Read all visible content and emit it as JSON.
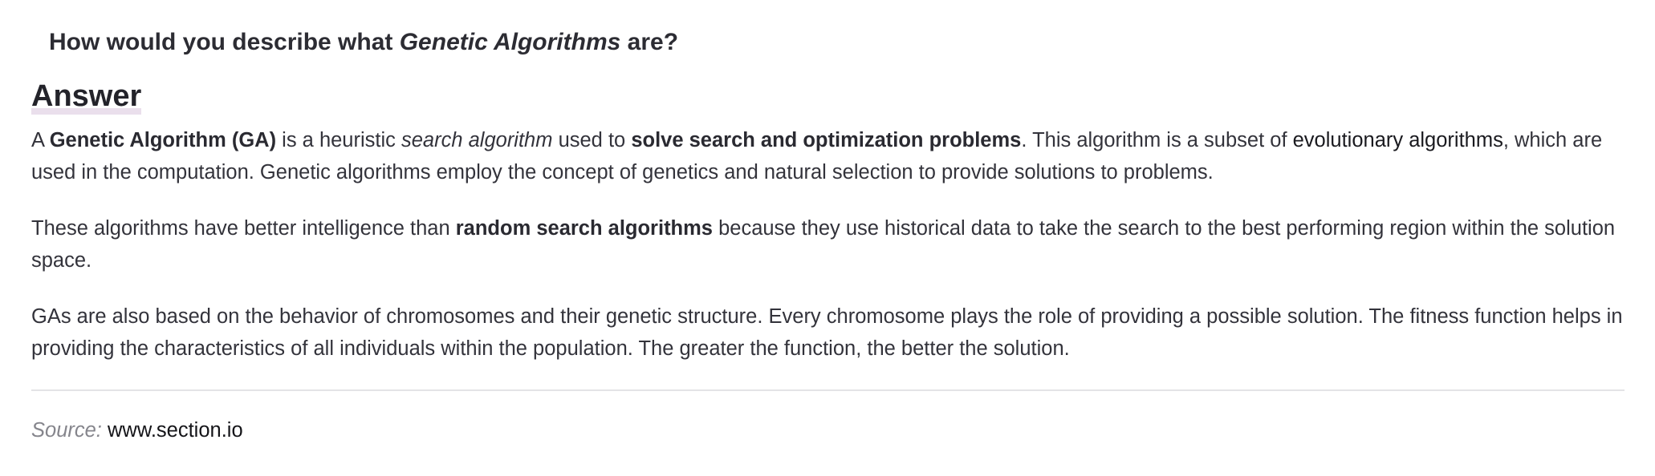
{
  "question": {
    "prefix": "How would you describe what ",
    "emphasis": "Genetic Algorithms",
    "suffix": " are?"
  },
  "answer_heading": "Answer",
  "paragraph1": {
    "t1": "A ",
    "b1": "Genetic Algorithm (GA)",
    "t2": " is a heuristic ",
    "i1": "search algorithm",
    "t3": " used to ",
    "b2": "solve search and optimization problems",
    "t4": ". This algorithm is a subset of ",
    "link": "evolutionary algorithms",
    "t5": ", which are used in the computation. Genetic algorithms employ the concept of genetics and natural selection to provide solutions to problems."
  },
  "paragraph2": {
    "t1": "These algorithms have better intelligence than ",
    "b1": "random search algorithms",
    "t2": " because they use historical data to take the search to the best performing region within the solution space."
  },
  "paragraph3": {
    "text": "GAs are also based on the behavior of chromosomes and their genetic structure. Every chromosome plays the role of providing a possible solution. The fitness function helps in providing the characteristics of all individuals within the population. The greater the function, the better the solution."
  },
  "source": {
    "label": "Source:",
    "url": "www.section.io"
  }
}
